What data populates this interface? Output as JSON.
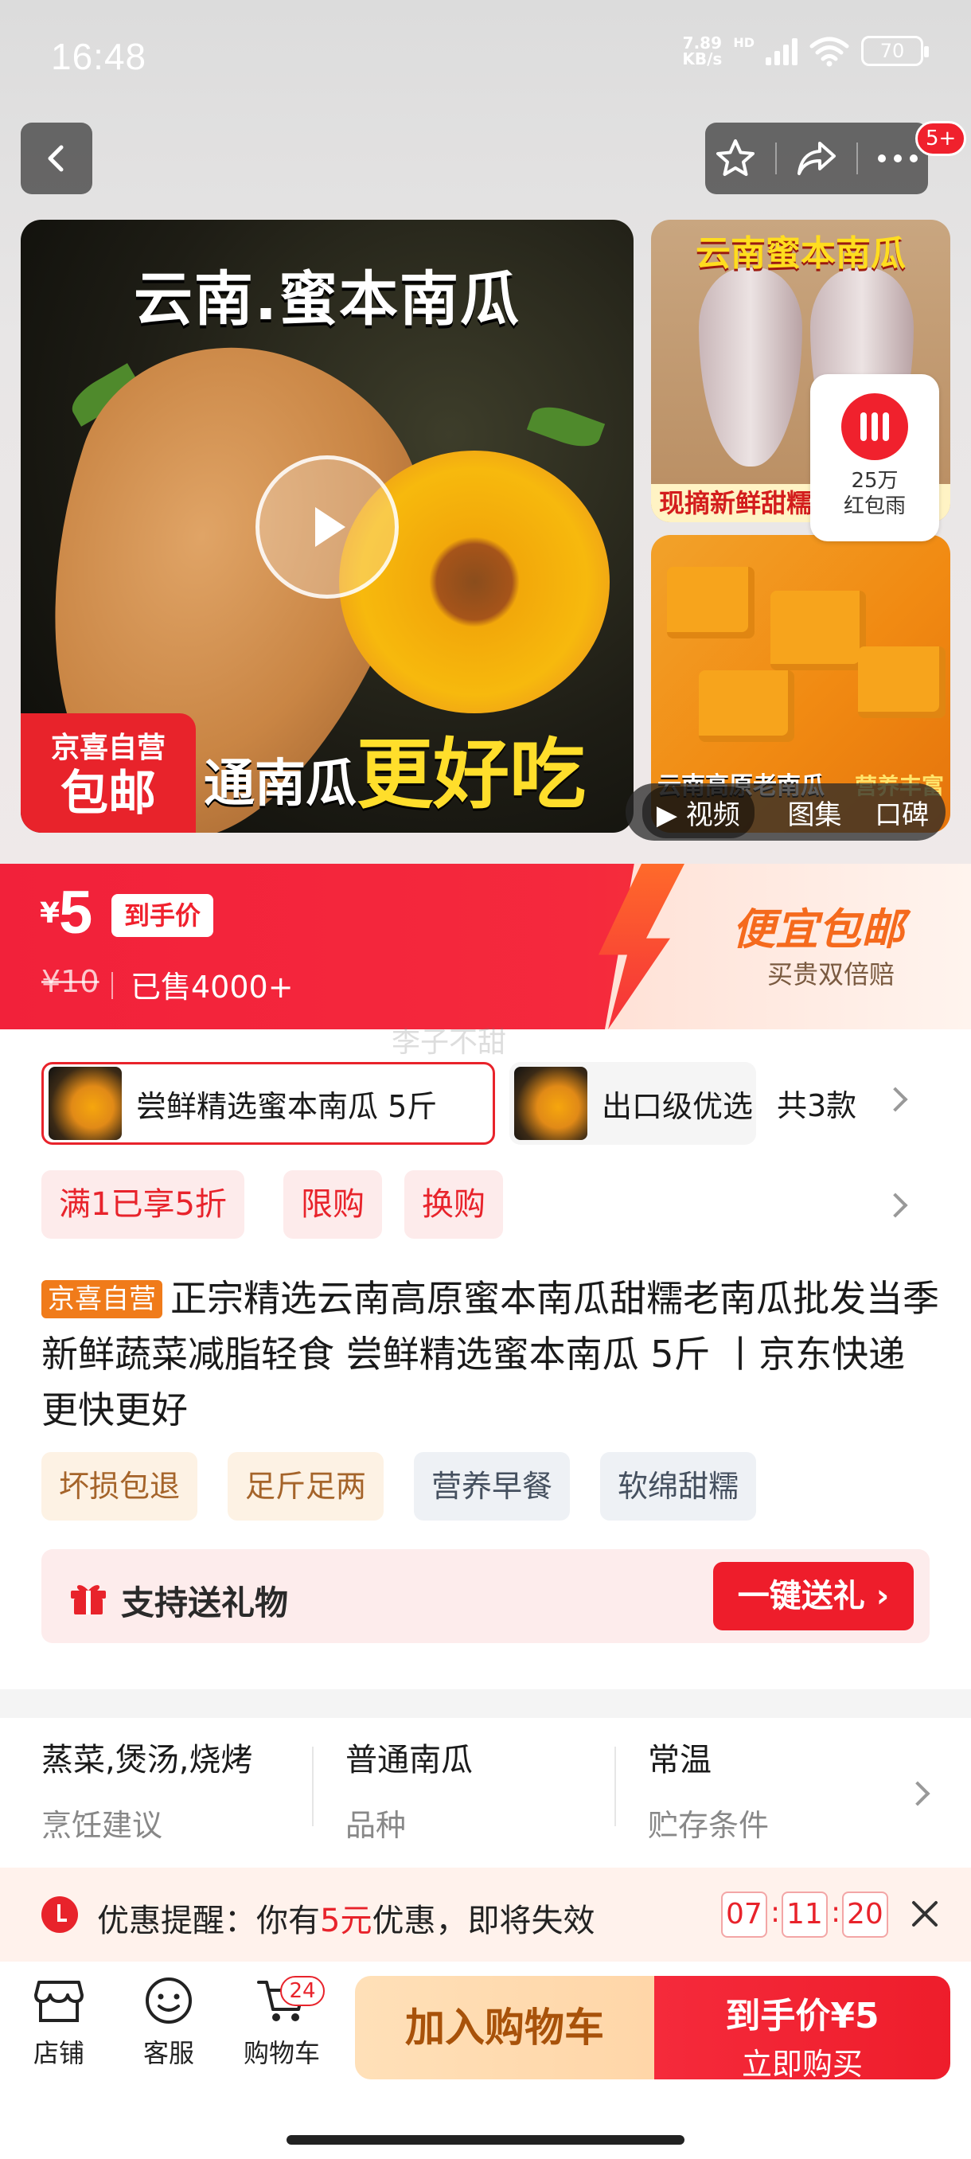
{
  "status_bar": {
    "time": "16:48",
    "net_speed_value": "7.89",
    "net_speed_unit": "KB/s",
    "hd": "HD",
    "battery": "70"
  },
  "nav": {
    "cart_badge": "5+"
  },
  "hero": {
    "main_title": "云南.蜜本南瓜",
    "self_op_line1": "京喜自营",
    "self_op_line2": "包邮",
    "slogan_prefix": "通南瓜",
    "slogan_highlight": "更好吃",
    "side1_title": "云南蜜本南瓜",
    "side1_caption": "现摘新鲜甜糯香",
    "side2_caption": "云南高原老南瓜",
    "side2_badge": "营养丰富",
    "red_packet_line1": "25万",
    "red_packet_line2": "红包雨",
    "tabs": [
      "视频",
      "图集",
      "口碑"
    ]
  },
  "price": {
    "currency": "¥",
    "amount": "5",
    "tag": "到手价",
    "original": "¥10",
    "sold": "已售4000+",
    "promo_title": "便宜包邮",
    "promo_sub": "买贵双倍赔",
    "watermark": "李子不甜"
  },
  "variants": {
    "selected": "尝鲜精选蜜本南瓜 5斤",
    "second": "出口级优选",
    "count": "共3款"
  },
  "promos": [
    "满1已享5折",
    "限购",
    "换购"
  ],
  "title": {
    "tag": "京喜自营",
    "text": "正宗精选云南高原蜜本南瓜甜糯老南瓜批发当季新鲜蔬菜减脂轻食 尝鲜精选蜜本南瓜 5斤 丨京东快递 更快更好"
  },
  "tags": [
    "坏损包退",
    "足斤足两",
    "营养早餐",
    "软绵甜糯"
  ],
  "gift": {
    "text": "支持送礼物",
    "button": "一键送礼 ›"
  },
  "specs": [
    {
      "value": "蒸菜,煲汤,烧烤",
      "key": "烹饪建议"
    },
    {
      "value": "普通南瓜",
      "key": "品种"
    },
    {
      "value": "常温",
      "key": "贮存条件"
    }
  ],
  "reminder": {
    "prefix": "优惠提醒：你有",
    "amount": "5元",
    "suffix": "优惠，即将失效",
    "hh": "07",
    "mm": "11",
    "ss": "20"
  },
  "bottom": {
    "store": "店铺",
    "service": "客服",
    "cart": "购物车",
    "cart_count": "24",
    "add_cart": "加入购物车",
    "buy_line1": "到手价¥5",
    "buy_line2": "立即购买"
  },
  "colors": {
    "accent_red": "#ee1d2b",
    "orange": "#f07b1a"
  }
}
